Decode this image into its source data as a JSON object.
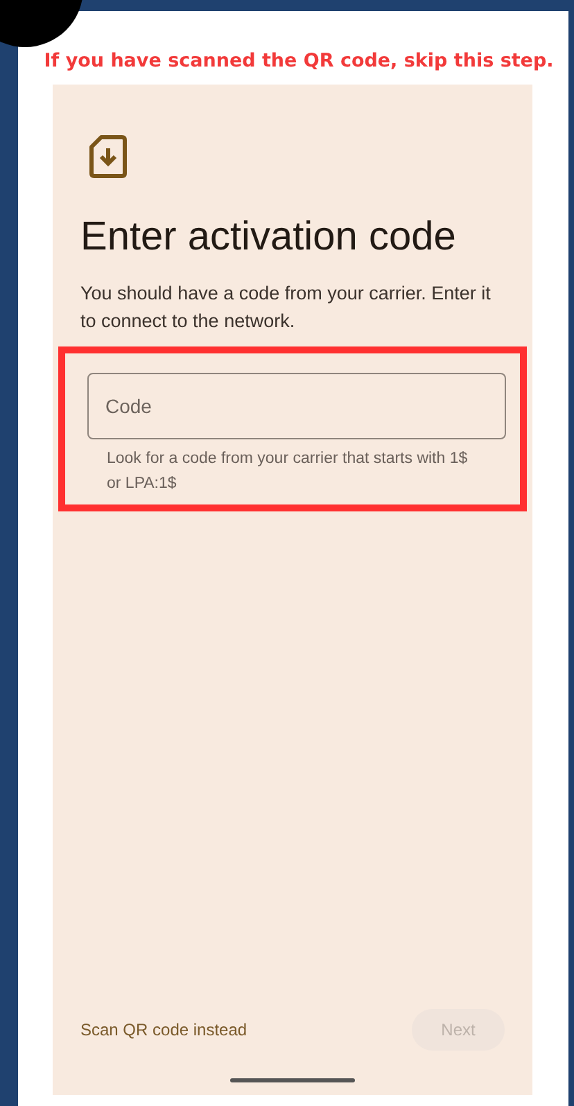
{
  "instruction": "If you have scanned the QR code, skip this step.",
  "screen": {
    "title": "Enter activation code",
    "description": "You should have a code from your carrier. Enter it to connect to the network.",
    "code_field": {
      "placeholder": "Code",
      "helper": "Look for a code from your carrier that starts with 1$ or LPA:1$",
      "highlighted": true
    },
    "secondary_action": {
      "label": "Scan QR code instead"
    },
    "next_button": {
      "label": "Next",
      "disabled": true
    }
  }
}
